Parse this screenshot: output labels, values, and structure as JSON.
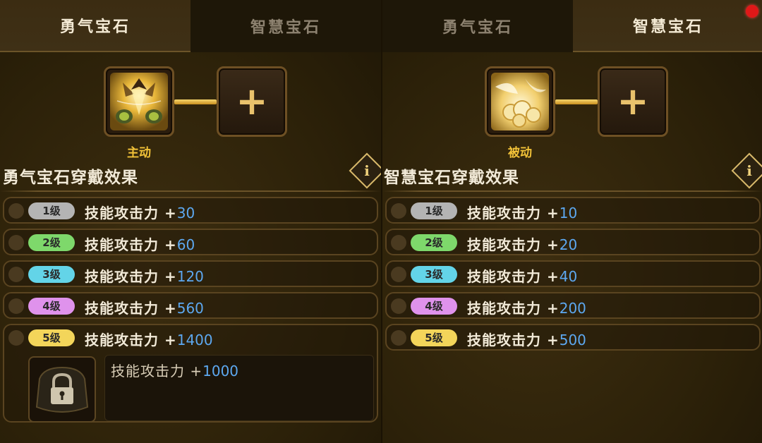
{
  "left_panel": {
    "tabs": [
      {
        "label": "勇气宝石",
        "active": true
      },
      {
        "label": "智慧宝石",
        "active": false
      }
    ],
    "gem_type": "主动",
    "section_title": "勇气宝石穿戴效果",
    "plus_icon": "+",
    "info_label": "i",
    "levels": [
      {
        "level": "1级",
        "effect": "技能攻击力 +",
        "value": "30"
      },
      {
        "level": "2级",
        "effect": "技能攻击力 +",
        "value": "60"
      },
      {
        "level": "3级",
        "effect": "技能攻击力 +",
        "value": "120"
      },
      {
        "level": "4级",
        "effect": "技能攻击力 +",
        "value": "560"
      },
      {
        "level": "5级",
        "effect": "技能攻击力 +",
        "value": "1400"
      }
    ],
    "bonus": {
      "effect": "技能攻击力 +",
      "value": "1000"
    }
  },
  "right_panel": {
    "tabs": [
      {
        "label": "勇气宝石",
        "active": false
      },
      {
        "label": "智慧宝石",
        "active": true
      }
    ],
    "gem_type": "被动",
    "section_title": "智慧宝石穿戴效果",
    "plus_icon": "+",
    "info_label": "i",
    "levels": [
      {
        "level": "1级",
        "effect": "技能攻击力 +",
        "value": "10"
      },
      {
        "level": "2级",
        "effect": "技能攻击力 +",
        "value": "20"
      },
      {
        "level": "3级",
        "effect": "技能攻击力 +",
        "value": "40"
      },
      {
        "level": "4级",
        "effect": "技能攻击力 +",
        "value": "200"
      },
      {
        "level": "5级",
        "effect": "技能攻击力 +",
        "value": "500"
      }
    ]
  },
  "colors": {
    "level_1": "#b4b4b4",
    "level_2": "#7ed86b",
    "level_3": "#63d4e8",
    "level_4": "#df92ec",
    "level_5": "#f3d55a",
    "value_blue": "#5da8f0",
    "gold_accent": "#f2c238"
  },
  "icons": [
    "courage-gem-icon",
    "wisdom-gem-icon",
    "plus-icon",
    "info-icon",
    "lock-icon",
    "notification-dot"
  ]
}
